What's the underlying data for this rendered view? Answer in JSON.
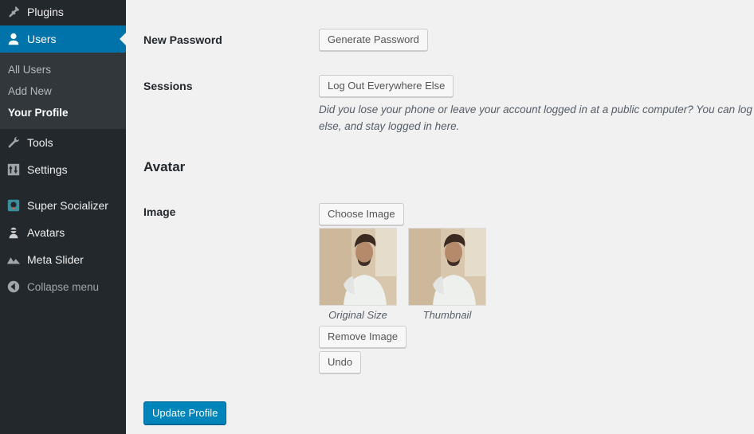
{
  "sidebar": {
    "items": [
      {
        "label": "Plugins",
        "icon": "plugin-icon"
      },
      {
        "label": "Users",
        "icon": "users-icon"
      },
      {
        "label": "Tools",
        "icon": "wrench-icon"
      },
      {
        "label": "Settings",
        "icon": "settings-icon"
      },
      {
        "label": "Super Socializer",
        "icon": "super-socializer-icon"
      },
      {
        "label": "Avatars",
        "icon": "avatars-icon"
      },
      {
        "label": "Meta Slider",
        "icon": "meta-slider-icon"
      }
    ],
    "submenu": [
      "All Users",
      "Add New",
      "Your Profile"
    ],
    "collapse_label": "Collapse menu"
  },
  "main": {
    "new_password_label": "New Password",
    "generate_password_button": "Generate Password",
    "sessions_label": "Sessions",
    "logout_button": "Log Out Everywhere Else",
    "sessions_description_line1": "Did you lose your phone or leave your account logged in at a public computer? You can log out everywhere",
    "sessions_description_line2": "else, and stay logged in here.",
    "avatar_heading": "Avatar",
    "image_label": "Image",
    "choose_image_button": "Choose Image",
    "original_size_caption": "Original Size",
    "thumbnail_caption": "Thumbnail",
    "remove_image_button": "Remove Image",
    "undo_button": "Undo",
    "update_profile_button": "Update Profile"
  },
  "colors": {
    "sidebar_bg": "#23282d",
    "submenu_bg": "#32373c",
    "accent": "#0073aa",
    "primary_button": "#0085ba"
  }
}
